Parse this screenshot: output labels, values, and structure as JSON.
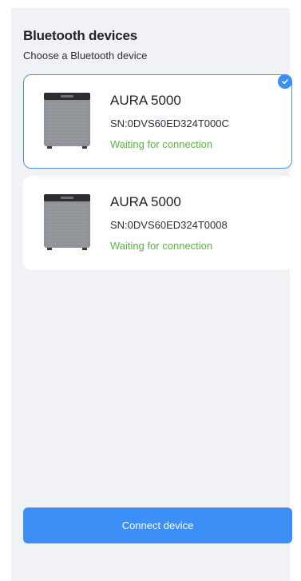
{
  "header": {
    "title": "Bluetooth devices",
    "subtitle": "Choose a Bluetooth device"
  },
  "devices": [
    {
      "name": "AURA 5000",
      "serial": "SN:0DVS60ED324T000C",
      "status": "Waiting for connection",
      "selected": true
    },
    {
      "name": "AURA 5000",
      "serial": "SN:0DVS60ED324T0008",
      "status": "Waiting for connection",
      "selected": false
    }
  ],
  "actions": {
    "connect_label": "Connect device"
  },
  "colors": {
    "accent": "#3b8ff6",
    "status_waiting": "#56b83f",
    "background": "#f1f2f5"
  },
  "icons": {
    "selected": "check-circle-icon"
  }
}
